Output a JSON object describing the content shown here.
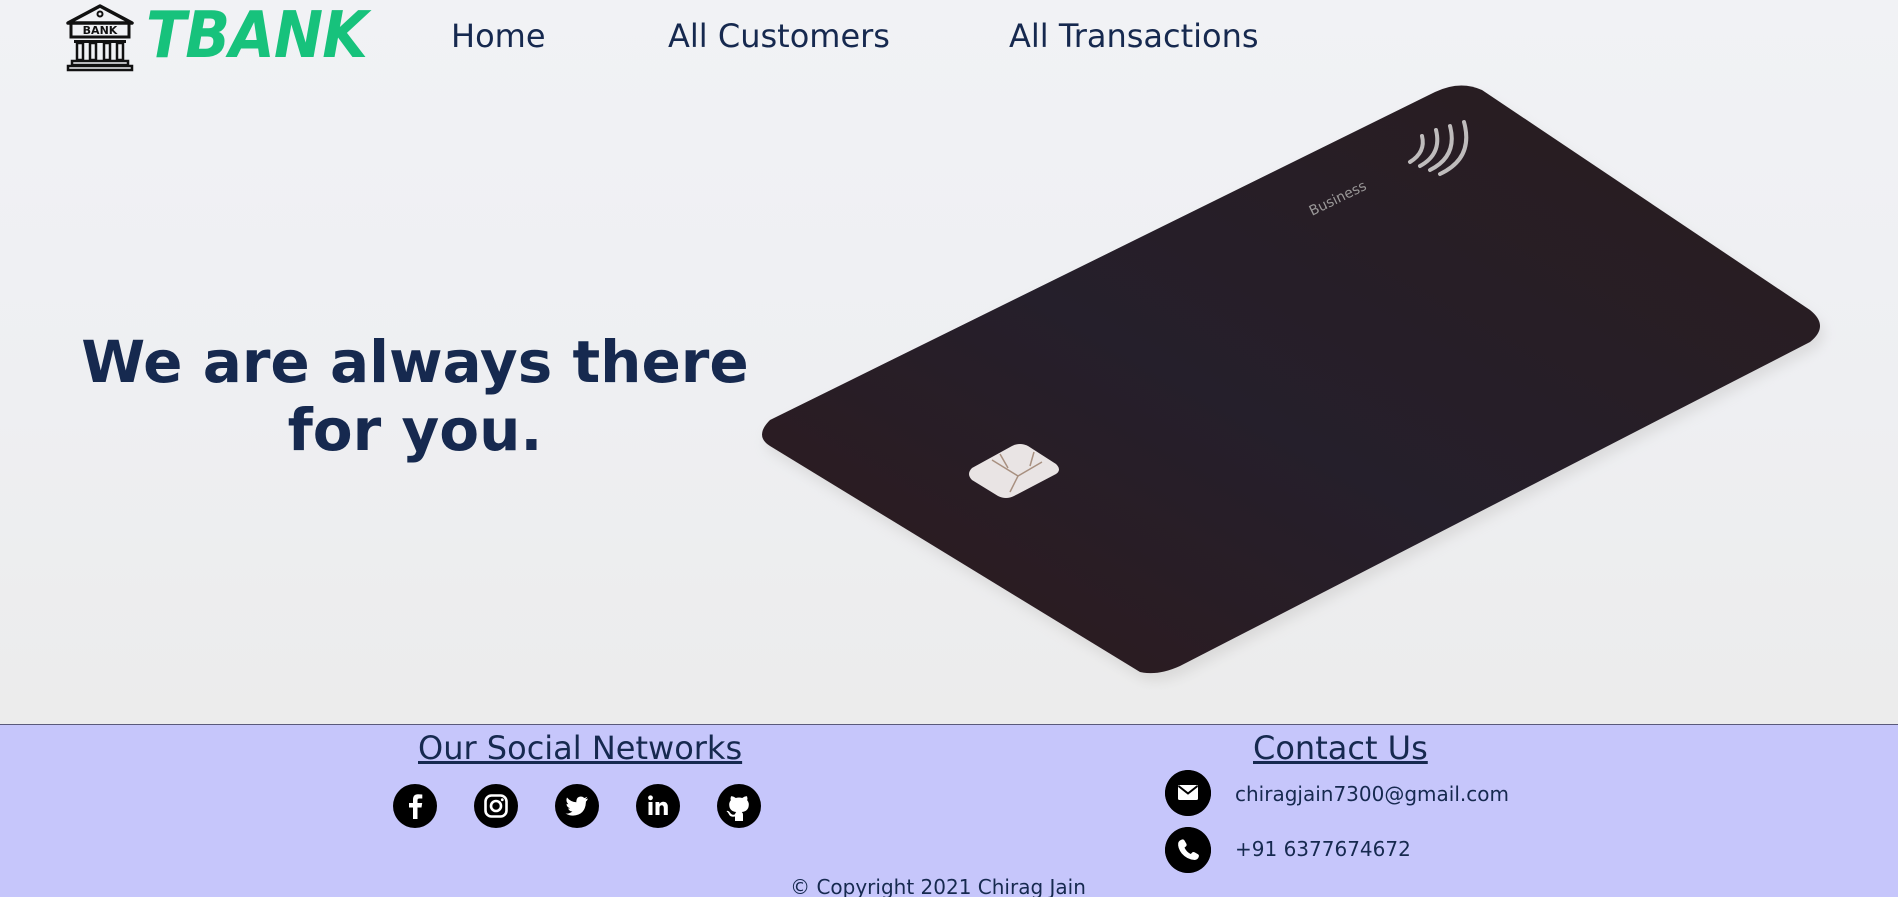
{
  "brand": {
    "name": "TBANK",
    "logo_icon": "bank-building-icon",
    "logo_icon_text": "BANK",
    "accent": "#17c27c"
  },
  "nav": {
    "home": "Home",
    "customers": "All Customers",
    "transactions": "All Transactions"
  },
  "hero": {
    "title_line1": "We are always there",
    "title_line2": "for you.",
    "card_label": "Business"
  },
  "footer": {
    "background": "#c6c6fb",
    "social_heading": "Our Social Networks",
    "social_icons": [
      "facebook-icon",
      "instagram-icon",
      "twitter-icon",
      "linkedin-icon",
      "github-icon"
    ],
    "contact_heading": "Contact Us",
    "email": "chiragjain7300@gmail.com",
    "phone": "+91 6377674672",
    "copyright": "© Copyright 2021 Chirag Jain"
  }
}
